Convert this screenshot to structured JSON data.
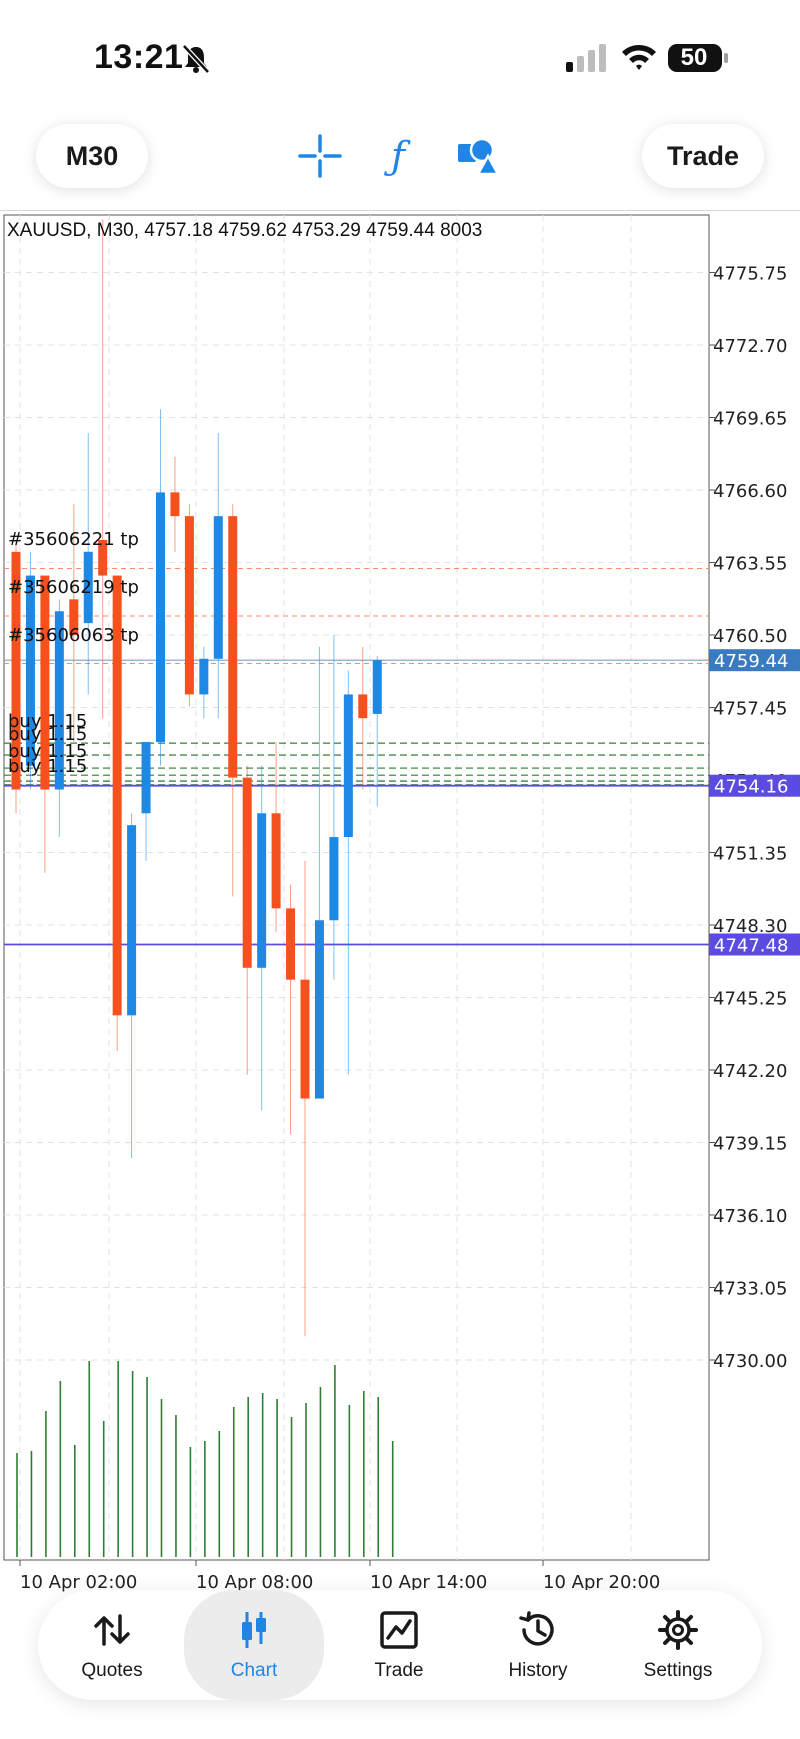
{
  "status": {
    "time": "13:21",
    "battery": "50"
  },
  "toolbar": {
    "timeframe": "M30",
    "trade": "Trade"
  },
  "chart": {
    "header": "XAUUSD, M30, 4757.18 4759.62 4753.29 4759.44 8003",
    "price_levels": [
      "4775.75",
      "4772.70",
      "4769.65",
      "4766.60",
      "4763.55",
      "4760.50",
      "4757.45",
      "4754.40",
      "4751.35",
      "4748.30",
      "4745.25",
      "4742.20",
      "4739.15",
      "4736.10",
      "4733.05",
      "4730.00"
    ],
    "time_labels": [
      "10 Apr 02:00",
      "10 Apr 08:00",
      "10 Apr 14:00",
      "10 Apr 20:00"
    ],
    "current_price_tag": "4759.44",
    "line_tags": [
      "4754.16",
      "4747.48"
    ],
    "trade_labels": [
      "#35606221 tp",
      "#35606219 tp",
      "#35606063 tp",
      "buy 1.15",
      "buy 1.15",
      "buy 1.15",
      "buy 1.15"
    ],
    "colors": {
      "bull": "#1e88e5",
      "bear": "#f4511e",
      "volume": "#2e7d32",
      "price_tag": "#3a7bbf",
      "line_tag": "#5b4be0"
    }
  },
  "chart_data": {
    "type": "candlestick",
    "symbol": "XAUUSD",
    "timeframe": "M30",
    "ylim": [
      4730.0,
      4778.0
    ],
    "candles": [
      {
        "o": 4764.0,
        "h": 4764.5,
        "l": 4753.0,
        "c": 4754.0
      },
      {
        "o": 4755.0,
        "h": 4764.0,
        "l": 4754.0,
        "c": 4763.0
      },
      {
        "o": 4763.0,
        "h": 4763.0,
        "l": 4750.5,
        "c": 4754.0
      },
      {
        "o": 4754.0,
        "h": 4762.0,
        "l": 4752.0,
        "c": 4761.5
      },
      {
        "o": 4762.0,
        "h": 4766.0,
        "l": 4756.0,
        "c": 4760.5
      },
      {
        "o": 4761.0,
        "h": 4769.0,
        "l": 4758.0,
        "c": 4764.0
      },
      {
        "o": 4764.5,
        "h": 4778.0,
        "l": 4757.0,
        "c": 4763.0
      },
      {
        "o": 4763.0,
        "h": 4763.0,
        "l": 4743.0,
        "c": 4744.5
      },
      {
        "o": 4744.5,
        "h": 4753.0,
        "l": 4738.5,
        "c": 4752.5
      },
      {
        "o": 4753.0,
        "h": 4756.0,
        "l": 4751.0,
        "c": 4756.0
      },
      {
        "o": 4756.0,
        "h": 4770.0,
        "l": 4755.0,
        "c": 4766.5
      },
      {
        "o": 4766.5,
        "h": 4768.0,
        "l": 4764.0,
        "c": 4765.5
      },
      {
        "o": 4765.5,
        "h": 4766.0,
        "l": 4757.5,
        "c": 4758.0
      },
      {
        "o": 4758.0,
        "h": 4760.0,
        "l": 4757.0,
        "c": 4759.5
      },
      {
        "o": 4759.5,
        "h": 4769.0,
        "l": 4757.0,
        "c": 4765.5
      },
      {
        "o": 4765.5,
        "h": 4766.0,
        "l": 4749.5,
        "c": 4754.5
      },
      {
        "o": 4754.5,
        "h": 4755.0,
        "l": 4742.0,
        "c": 4746.5
      },
      {
        "o": 4746.5,
        "h": 4755.0,
        "l": 4740.5,
        "c": 4753.0
      },
      {
        "o": 4753.0,
        "h": 4756.0,
        "l": 4748.0,
        "c": 4749.0
      },
      {
        "o": 4749.0,
        "h": 4750.0,
        "l": 4739.5,
        "c": 4746.0
      },
      {
        "o": 4746.0,
        "h": 4751.0,
        "l": 4731.0,
        "c": 4741.0
      },
      {
        "o": 4741.0,
        "h": 4760.0,
        "l": 4741.0,
        "c": 4748.5
      },
      {
        "o": 4748.5,
        "h": 4760.5,
        "l": 4746.0,
        "c": 4752.0
      },
      {
        "o": 4752.0,
        "h": 4759.0,
        "l": 4742.0,
        "c": 4758.0
      },
      {
        "o": 4758.0,
        "h": 4760.0,
        "l": 4754.0,
        "c": 4757.0
      },
      {
        "o": 4757.18,
        "h": 4759.62,
        "l": 4753.29,
        "c": 4759.44
      }
    ],
    "volume_relative": [
      0.52,
      0.53,
      0.73,
      0.88,
      0.56,
      0.98,
      0.68,
      0.98,
      0.93,
      0.9,
      0.79,
      0.71,
      0.55,
      0.58,
      0.63,
      0.75,
      0.8,
      0.82,
      0.79,
      0.7,
      0.77,
      0.85,
      0.96,
      0.76,
      0.83,
      0.8,
      0.58
    ],
    "lines": [
      {
        "type": "tp",
        "price": 4763.3
      },
      {
        "type": "tp",
        "price": 4761.3
      },
      {
        "type": "tp",
        "price": 4759.3
      },
      {
        "type": "buy",
        "price": 4755.95
      },
      {
        "type": "buy",
        "price": 4755.45
      },
      {
        "type": "buy",
        "price": 4754.9
      },
      {
        "type": "buy",
        "price": 4754.6
      },
      {
        "type": "buy",
        "price": 4754.35
      },
      {
        "type": "buy",
        "price": 4754.2
      },
      {
        "type": "level",
        "price": 4754.16
      },
      {
        "type": "level",
        "price": 4747.48
      },
      {
        "type": "current",
        "price": 4759.44
      }
    ]
  },
  "nav": [
    {
      "label": "Quotes",
      "icon": "quotes-icon"
    },
    {
      "label": "Chart",
      "icon": "chart-icon",
      "active": true
    },
    {
      "label": "Trade",
      "icon": "trade-icon"
    },
    {
      "label": "History",
      "icon": "history-icon"
    },
    {
      "label": "Settings",
      "icon": "settings-icon"
    }
  ]
}
